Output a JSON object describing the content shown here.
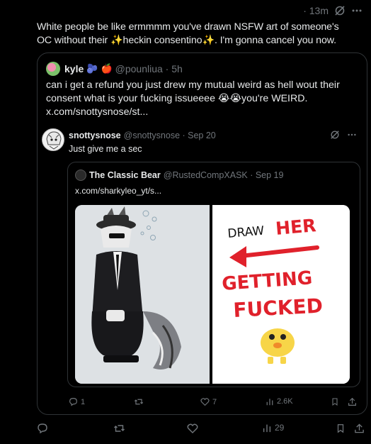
{
  "post": {
    "time": "· 13m",
    "text_part1": "White people be like ermmmm you've drawn NSFW art of someone's OC without their ",
    "sparkle_left": "✨",
    "text_word": "heckin consentino",
    "sparkle_right": "✨",
    "text_part2": ". I'm gonna cancel you now."
  },
  "quote1": {
    "name": "kyle",
    "emoji1": "🫐",
    "emoji2": "🍎",
    "handle": "@pounliua · 5h",
    "text": "can i get a refund you just drew my mutual weird as hell wout their consent what is your fucking issueeee 😭😭you're WEIRD.",
    "link": "x.com/snottysnose/st..."
  },
  "reply": {
    "name": "snottysnose",
    "handle": "@snottysnose · Sep 20",
    "text": "Just give me a sec"
  },
  "quote2": {
    "name": "The Classic Bear",
    "handle": "@RustedCompXASK · Sep 19",
    "link": "x.com/sharkyleo_yt/s..."
  },
  "image_right": {
    "line1_a": "DRAW",
    "line1_b": "HER",
    "line2": "GETTING",
    "line3": "FUCKED"
  },
  "inner_actions": {
    "replies": "1",
    "likes": "7",
    "views": "2.6K"
  },
  "outer_actions": {
    "views": "29"
  },
  "colors": {
    "background": "#000000",
    "text": "#e7e9ea",
    "muted": "#71767b",
    "border": "#2f3336",
    "red_text": "#e0212b"
  }
}
